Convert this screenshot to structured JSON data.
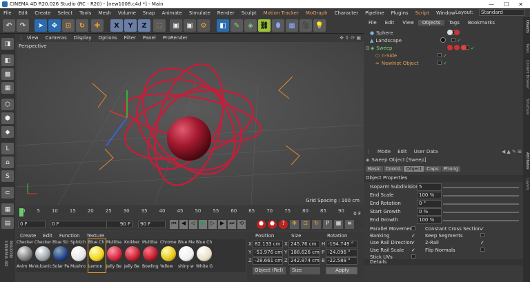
{
  "window": {
    "title": "CINEMA 4D R20.026 Studio (RC - R20) - [new1008.c4d *] - Main",
    "min": "—",
    "max": "☐",
    "close": "✕"
  },
  "menu": [
    "File",
    "Edit",
    "Create",
    "Select",
    "Tools",
    "Mesh",
    "Volume",
    "Snap",
    "Animate",
    "Simulate",
    "Render",
    "Sculpt",
    "Motion Tracker",
    "MoGraph",
    "Character",
    "Pipeline",
    "Plugins",
    "Script",
    "Window"
  ],
  "layout": {
    "label": "Layout:",
    "value": "Standard"
  },
  "viewport": {
    "menu": [
      "View",
      "Cameras",
      "Display",
      "Options",
      "Filter",
      "Panel",
      "ProRender"
    ],
    "name": "Perspective",
    "grid": "Grid Spacing : 100 cm"
  },
  "timeline": {
    "ticks": [
      "0",
      "5",
      "10",
      "15",
      "20",
      "25",
      "30",
      "35",
      "40",
      "45",
      "50",
      "55",
      "60",
      "65",
      "70",
      "75",
      "80",
      "85",
      "90"
    ],
    "end_label": "0 F"
  },
  "transport": {
    "f1": "0 F",
    "f2": "0 F",
    "f3": "90 F",
    "f4": "90 F"
  },
  "materials": {
    "menu": [
      "Create",
      "Edit",
      "Function",
      "Texture"
    ],
    "items": [
      {
        "top": "Checker",
        "bottom": "Anim Me",
        "color": "#7a7a7a"
      },
      {
        "top": "Checker",
        "bottom": "Vulcanic",
        "color": "#9aa2a8"
      },
      {
        "top": "Blue Str",
        "bottom": "Solar Pa",
        "color": "#203f8a"
      },
      {
        "top": "Splotch",
        "bottom": "Mushro",
        "color": "#e6e6e6"
      },
      {
        "top": "Blue Ch",
        "bottom": "Lemon",
        "color": "#f2d21b"
      },
      {
        "top": "Multiba",
        "bottom": "Jelly Be",
        "color": "#d0263c"
      },
      {
        "top": "Knikker",
        "bottom": "Jelly Be",
        "color": "#c5202f"
      },
      {
        "top": "Multiba",
        "bottom": "Bowling",
        "color": "#b81a2a"
      },
      {
        "top": "Chrome",
        "bottom": "Yellow",
        "color": "#e8c51a"
      },
      {
        "top": "Blue Me",
        "bottom": "shiny w",
        "color": "#f0f0f0"
      },
      {
        "top": "Blue Ch",
        "bottom": "White G",
        "color": "#e8e0c8"
      }
    ]
  },
  "coords": {
    "headers": [
      "Position",
      "Size",
      "Rotation"
    ],
    "rows": [
      {
        "a": "X",
        "pos": "82.133 cm",
        "sizeA": "X",
        "size": "245.76 cm",
        "rotA": "H",
        "rot": "-194.749 °"
      },
      {
        "a": "Y",
        "pos": "-53.976 cm",
        "sizeA": "Y",
        "size": "188.626 cm",
        "rotA": "P",
        "rot": "-24.096 °"
      },
      {
        "a": "Z",
        "pos": "-28.661 cm",
        "sizeA": "Z",
        "size": "242.874 cm",
        "rotA": "B",
        "rot": "-22.588 °"
      }
    ],
    "mode1": "Object (Rel)",
    "mode2": "Size",
    "apply": "Apply"
  },
  "objects": {
    "menu": [
      "File",
      "Edit",
      "View",
      "Objects",
      "Tags",
      "Bookmarks"
    ],
    "rows": [
      {
        "name": "Sphere",
        "color": "#cfcfcf",
        "indent": 0
      },
      {
        "name": "Landscape",
        "color": "#cfcfcf",
        "indent": 0
      },
      {
        "name": "Sweep",
        "color": "#7cd67c",
        "indent": 0
      },
      {
        "name": "n-Side",
        "color": "#e0a050",
        "indent": 1
      },
      {
        "name": "Newlnot Object",
        "color": "#e0a050",
        "indent": 1
      }
    ]
  },
  "attributes": {
    "menu": [
      "Mode",
      "Edit",
      "User Data"
    ],
    "object": "Sweep Object [Sweep]",
    "tabs": [
      "Basic",
      "Coord.",
      "Object",
      "Caps",
      "Phong"
    ],
    "section": "Object Properties",
    "props": [
      {
        "label": "Isoparm Subdivision",
        "value": "5"
      },
      {
        "label": "End Scale",
        "value": "100 %"
      },
      {
        "label": "End Rotation",
        "value": "0 °"
      },
      {
        "label": "Start Growth",
        "value": "0 %"
      },
      {
        "label": "End Growth",
        "value": "100 %"
      }
    ],
    "checks_left": [
      "Parallel Movement",
      "Banking",
      "Use Rail Direction",
      "Use Rail Scale",
      "Stick UVs"
    ],
    "checks_right": [
      "Constant Cross Section",
      "Keep Segments",
      "2-Rail",
      "Flip Normals"
    ],
    "details": "Details"
  },
  "side_tabs": [
    "Objects",
    "Takes",
    "Content Browser",
    "Structure",
    "Attributes",
    "Layers"
  ]
}
